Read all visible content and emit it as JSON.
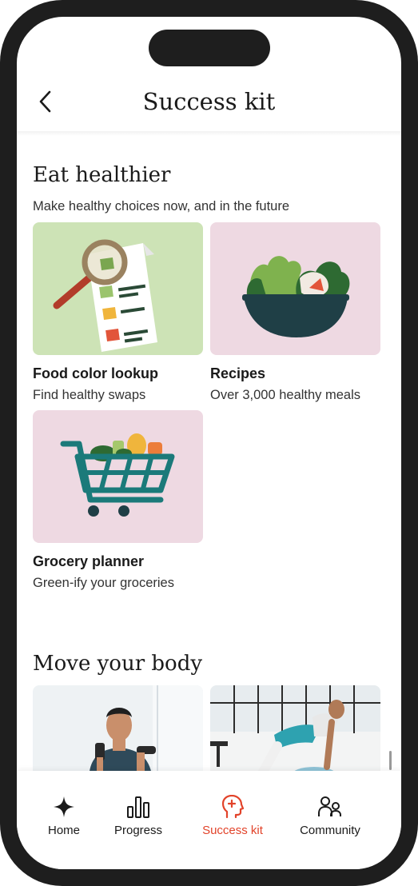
{
  "header": {
    "title": "Success kit",
    "back_icon": "chevron-left-icon"
  },
  "sections": {
    "eat": {
      "title": "Eat healthier",
      "subtitle": "Make healthy choices now, and in the future",
      "cards": [
        {
          "title": "Food color lookup",
          "subtitle": "Find healthy swaps",
          "bg": "#cde3b6",
          "icon": "magnifier-checklist-illustration"
        },
        {
          "title": "Recipes",
          "subtitle": "Over 3,000 healthy meals",
          "bg": "#eed9e2",
          "icon": "salad-bowl-illustration"
        },
        {
          "title": "Grocery planner",
          "subtitle": "Green-ify your groceries",
          "bg": "#eed9e2",
          "icon": "shopping-cart-illustration"
        }
      ]
    },
    "move": {
      "title": "Move your body",
      "photos": [
        "dumbbell-workout-photo",
        "stretch-workout-photo"
      ]
    }
  },
  "tabbar": {
    "items": [
      {
        "label": "Home",
        "icon": "sparkle-icon",
        "active": false
      },
      {
        "label": "Progress",
        "icon": "bar-chart-icon",
        "active": false
      },
      {
        "label": "Success kit",
        "icon": "head-plus-icon",
        "active": true
      },
      {
        "label": "Community",
        "icon": "people-icon",
        "active": false
      }
    ]
  },
  "colors": {
    "accent": "#e2432a",
    "text": "#1a1a1a",
    "frame": "#1e1e1e"
  }
}
